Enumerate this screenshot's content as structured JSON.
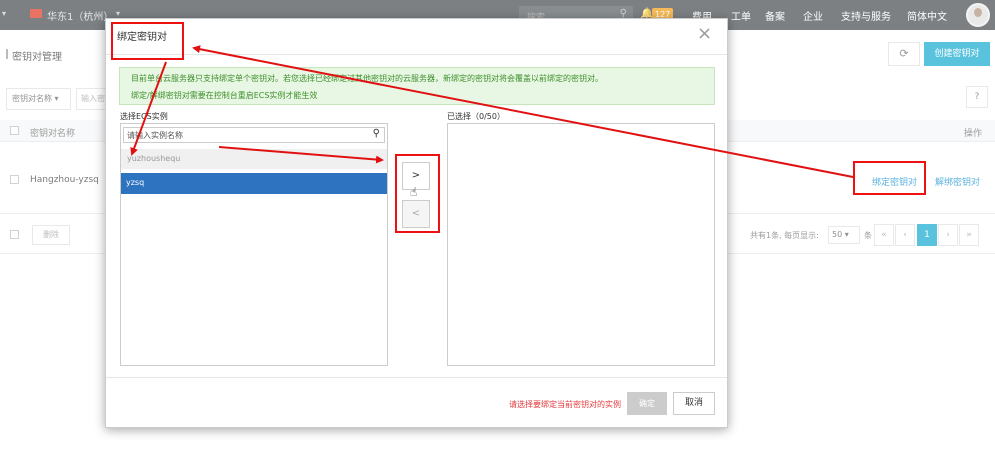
{
  "topbar": {
    "region": "华东1（杭州）",
    "search_placeholder": "搜索",
    "notification_count": "127",
    "nav": [
      "费用",
      "工单",
      "备案",
      "企业",
      "支持与服务",
      "简体中文"
    ]
  },
  "page": {
    "title": "密钥对管理",
    "create_button": "创建密钥对",
    "refresh_icon": "refresh-icon",
    "filter_select": "密钥对名称 ▾",
    "filter_input_placeholder": "输入密",
    "help_button": "?",
    "table": {
      "col_name": "密钥对名称",
      "col_op": "操作",
      "rows": [
        {
          "name": "Hangzhou-yzsq",
          "bind": "绑定密钥对",
          "unbind": "解绑密钥对"
        }
      ]
    },
    "delete_button": "删除",
    "pagination": {
      "info": "共有1条, 每页显示:",
      "page_size": "50 ▾",
      "unit": "条",
      "buttons": [
        "«",
        "‹",
        "1",
        "›",
        "»"
      ],
      "current": "1"
    }
  },
  "dialog": {
    "title": "绑定密钥对",
    "close_icon": "close-icon",
    "notice_line1": "目前单台云服务器只支持绑定单个密钥对。若您选择已经绑定过其他密钥对的云服务器，新绑定的密钥对将会覆盖以前绑定的密钥对。",
    "notice_line2": "绑定/解绑密钥对需要在控制台重启ECS实例才能生效",
    "left_label": "选择ECS实例",
    "right_label": "已选择（0/50）",
    "search_placeholder": "请输入实例名称",
    "instances": [
      {
        "name": "yuzhoushequ",
        "state": "disabled"
      },
      {
        "name": "yzsq",
        "state": "selected"
      }
    ],
    "move_right": ">",
    "move_left": "<",
    "footer_message": "请选择要绑定当前密钥对的实例",
    "confirm_button": "确定",
    "cancel_button": "取消"
  },
  "colors": {
    "topbar": "#373d41",
    "accent": "#00a2ca",
    "selected": "#2d73c0",
    "annotation": "#e11111",
    "error_text": "#e4393c"
  }
}
